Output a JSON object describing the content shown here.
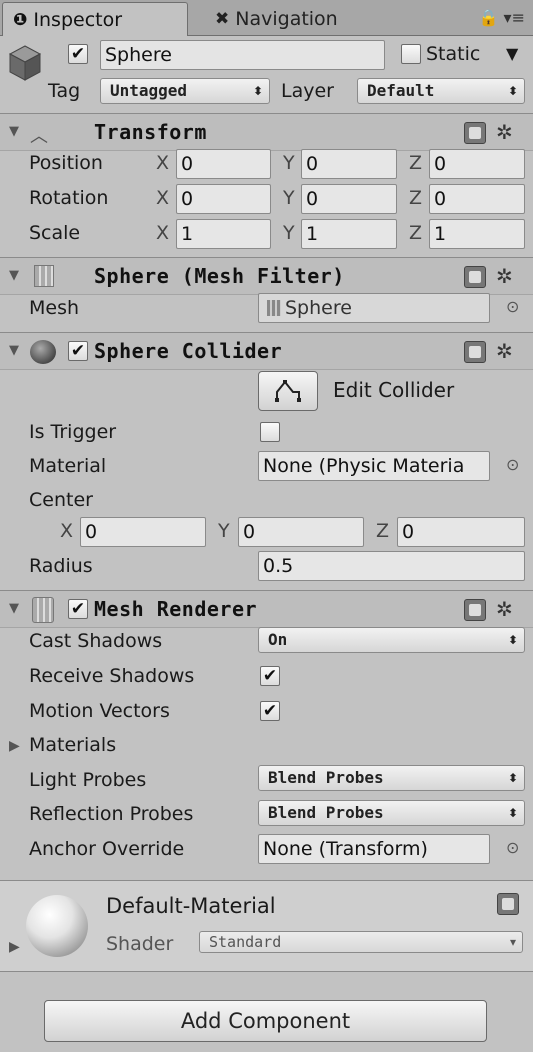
{
  "tabs": {
    "inspector": "Inspector",
    "navigation": "Navigation"
  },
  "object": {
    "name": "Sphere",
    "static_label": "Static",
    "tag_label": "Tag",
    "tag_value": "Untagged",
    "layer_label": "Layer",
    "layer_value": "Default"
  },
  "transform": {
    "title": "Transform",
    "rows": [
      {
        "label": "Position",
        "x": "0",
        "y": "0",
        "z": "0"
      },
      {
        "label": "Rotation",
        "x": "0",
        "y": "0",
        "z": "0"
      },
      {
        "label": "Scale",
        "x": "1",
        "y": "1",
        "z": "1"
      }
    ]
  },
  "axes": {
    "x": "X",
    "y": "Y",
    "z": "Z"
  },
  "mesh_filter": {
    "title": "Sphere (Mesh Filter)",
    "mesh_label": "Mesh",
    "mesh_value": "Sphere"
  },
  "sphere_collider": {
    "title": "Sphere Collider",
    "edit_label": "Edit Collider",
    "is_trigger_label": "Is Trigger",
    "material_label": "Material",
    "material_value": "None (Physic Materia",
    "center_label": "Center",
    "center_x": "0",
    "center_y": "0",
    "center_z": "0",
    "radius_label": "Radius",
    "radius_value": "0.5"
  },
  "mesh_renderer": {
    "title": "Mesh Renderer",
    "cast_shadows_label": "Cast Shadows",
    "cast_shadows_value": "On",
    "receive_shadows_label": "Receive Shadows",
    "motion_vectors_label": "Motion Vectors",
    "materials_label": "Materials",
    "light_probes_label": "Light Probes",
    "light_probes_value": "Blend Probes",
    "reflection_probes_label": "Reflection Probes",
    "reflection_probes_value": "Blend Probes",
    "anchor_override_label": "Anchor Override",
    "anchor_override_value": "None (Transform)"
  },
  "material": {
    "name": "Default-Material",
    "shader_label": "Shader",
    "shader_value": "Standard"
  },
  "add_component": "Add Component",
  "check_glyph": "✔"
}
